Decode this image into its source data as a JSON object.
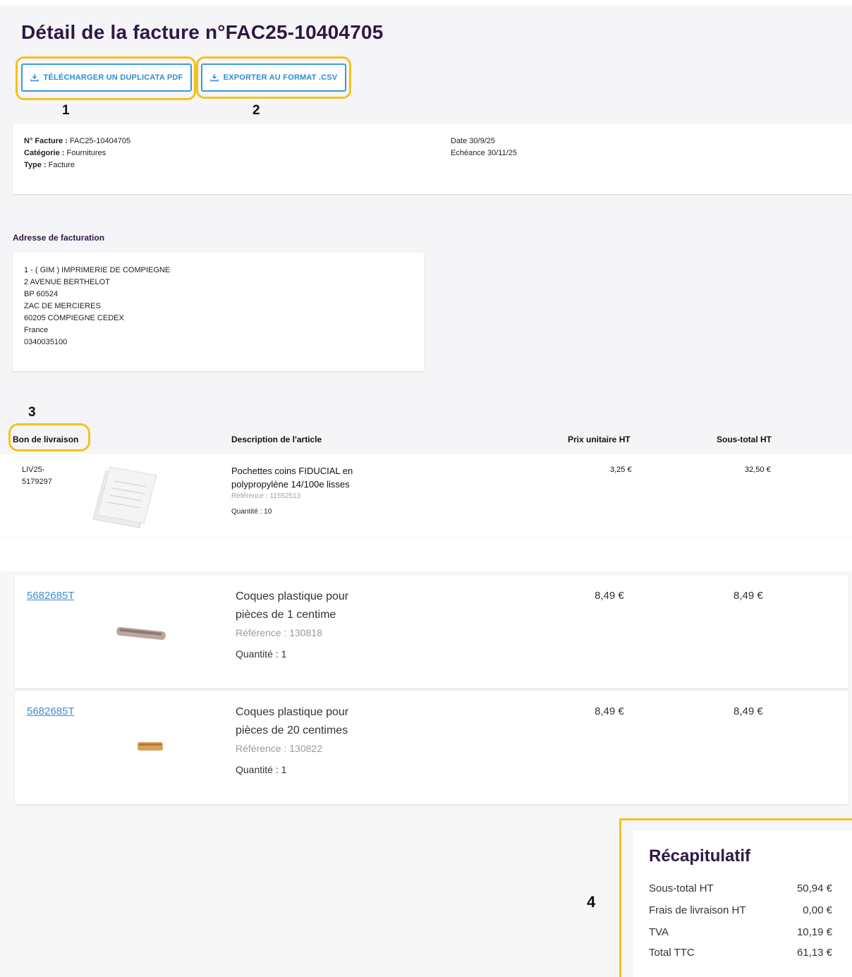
{
  "page": {
    "title": "Détail de la facture n°FAC25-10404705"
  },
  "actions": {
    "pdf_label": "TÉLÉCHARGER UN DUPLICATA PDF",
    "csv_label": "EXPORTER AU FORMAT .CSV"
  },
  "callouts": [
    "1",
    "2",
    "3",
    "4"
  ],
  "invoice": {
    "number_label": "N° Facture :",
    "number_value": "FAC25-10404705",
    "category_label": "Catégorie :",
    "category_value": "Fournitures",
    "type_label": "Type :",
    "type_value": "Facture",
    "date": "Date 30/9/25",
    "due": "Echéance 30/11/25"
  },
  "billing": {
    "heading": "Adresse de facturation",
    "lines": [
      "1 - ( GIM ) IMPRIMERIE DE COMPIEGNE",
      "2 AVENUE BERTHELOT",
      "BP 60524",
      "ZAC DE MERCIERES",
      "60205  COMPIEGNE CEDEX",
      "France",
      "0340035100"
    ]
  },
  "table": {
    "headers": [
      "Bon de livraison",
      "Description de l'article",
      "Prix unitaire HT",
      "Sous-total HT"
    ],
    "rows": [
      {
        "delivery_line1": "LIV25-",
        "delivery_line2": "5179297",
        "desc_line1": "Pochettes coins FIDUCIAL en",
        "desc_line2": "polypropylène 14/100e lisses",
        "reference": "Référence : 11552513",
        "quantity": "Quantité : 10",
        "unit_price": "3,25 €",
        "subtotal": "32,50 €"
      },
      {
        "delivery": "5682685T",
        "desc_line1": "Coques plastique pour",
        "desc_line2": "pièces de 1 centime",
        "reference": "Référence : 130818",
        "quantity": "Quantité : 1",
        "unit_price": "8,49 €",
        "subtotal": "8,49 €"
      },
      {
        "delivery": "5682685T",
        "desc_line1": "Coques plastique pour",
        "desc_line2": "pièces de 20 centimes",
        "reference": "Référence : 130822",
        "quantity": "Quantité : 1",
        "unit_price": "8,49 €",
        "subtotal": "8,49 €"
      }
    ]
  },
  "recap": {
    "title": "Récapitulatif",
    "rows": [
      {
        "label": "Sous-total HT",
        "value": "50,94 €"
      },
      {
        "label": "Frais de livraison HT",
        "value": "0,00 €"
      },
      {
        "label": "TVA",
        "value": "10,19 €"
      },
      {
        "label": "Total TTC",
        "value": "61,13 €"
      }
    ]
  },
  "colors": {
    "title": "#2e1845",
    "button_border": "#3a9ad9",
    "highlight": "#f4c21c",
    "link": "#3b8fd6"
  }
}
